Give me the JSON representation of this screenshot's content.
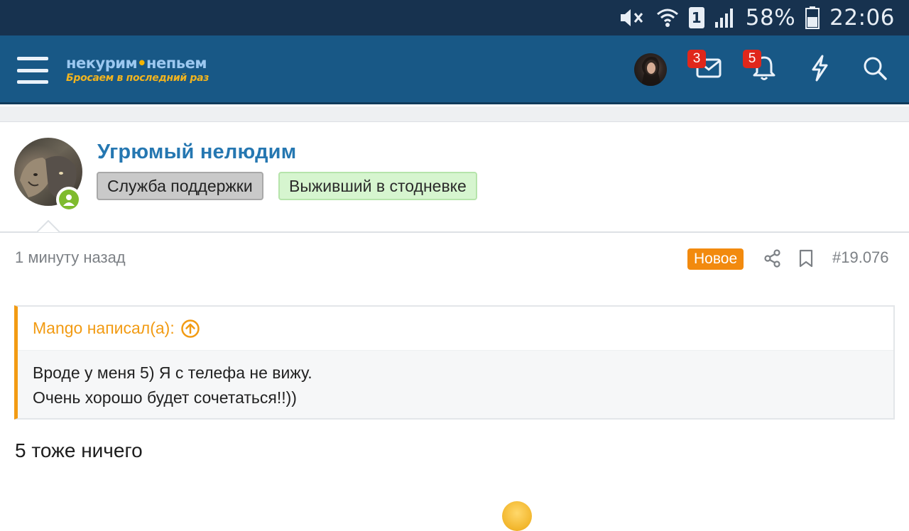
{
  "status_bar": {
    "battery": "58%",
    "time": "22:06",
    "sim": "1",
    "icons": [
      "mute-icon",
      "wifi-icon",
      "sim-icon",
      "signal-icon",
      "battery-icon"
    ]
  },
  "header": {
    "logo_main_left": "некурим",
    "logo_main_right": "непьем",
    "logo_tagline": "Бросаем в последний раз",
    "messages_count": "3",
    "alerts_count": "5",
    "icons": [
      "menu-icon",
      "mail-icon",
      "bell-icon",
      "lightning-icon",
      "search-icon"
    ],
    "colors": {
      "bar": "#185886",
      "status": "#17324f",
      "badge": "#e0271b",
      "logo_accent": "#f2b41e"
    }
  },
  "post": {
    "author": "Угрюмый нелюдим",
    "badges": [
      "Служба поддержки",
      "Выживший в стодневке"
    ],
    "time": "1 минуту назад",
    "new_label": "Новое",
    "number": "#19.076",
    "quote": {
      "author_line": "Mango написал(а):",
      "lines": [
        "Вроде у меня 5) Я с телефа не вижу.",
        "Очень хорошо будет сочетаться!!))"
      ]
    },
    "text": "5 тоже ничего",
    "colors": {
      "username": "#2577b1",
      "new": "#f28a0e",
      "quote_accent": "#f29b13",
      "online": "#7fbb2e"
    }
  }
}
